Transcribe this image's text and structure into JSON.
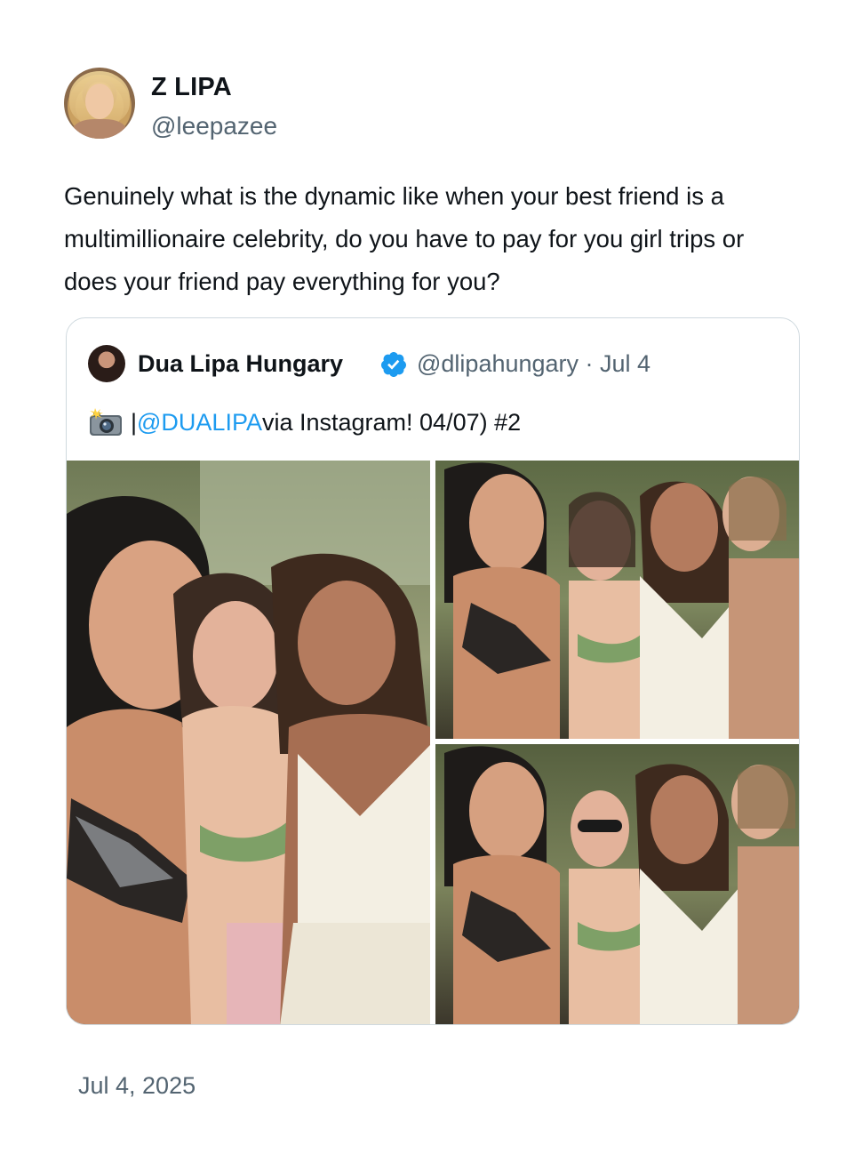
{
  "tweet": {
    "author": {
      "display_name": "Z LIPA",
      "handle": "@leepazee"
    },
    "text": "Genuinely what is the dynamic like when your best friend is a multimillionaire celebrity, do you have to pay for you girl trips or does your friend pay everything for you?",
    "timestamp": "Jul 4, 2025"
  },
  "quote": {
    "display_name": "Dua Lipa Hungary",
    "handle_date": "@dlipahungary · Jul 4",
    "text_prefix": "| ",
    "mention": "@DUALIPA",
    "text_suffix": " via Instagram! 04/07) #2",
    "icons": {
      "verified": "verified-badge-icon",
      "camera": "camera-flash-icon"
    },
    "colors": {
      "link": "#1d9bf0",
      "verified": "#1d9bf0",
      "secondary_text": "#536471",
      "border": "#cfd9de"
    }
  }
}
